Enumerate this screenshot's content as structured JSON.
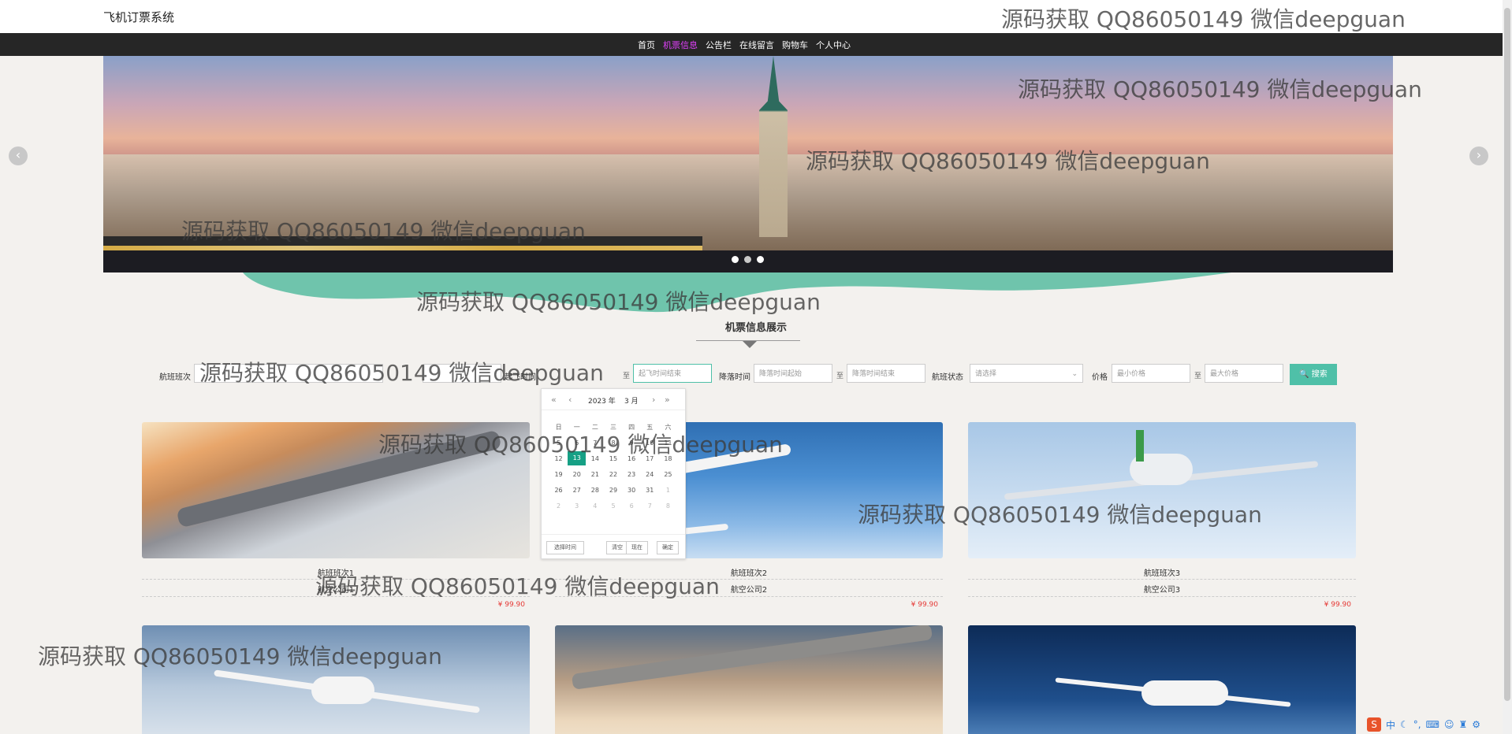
{
  "site": {
    "title": "飞机订票系统"
  },
  "nav": {
    "items": [
      {
        "label": "首页",
        "active": false
      },
      {
        "label": "机票信息",
        "active": true
      },
      {
        "label": "公告栏",
        "active": false
      },
      {
        "label": "在线留言",
        "active": false
      },
      {
        "label": "购物车",
        "active": false
      },
      {
        "label": "个人中心",
        "active": false
      }
    ]
  },
  "banner": {
    "prev_icon": "‹",
    "next_icon": "›",
    "dot_count": 3,
    "active_dot": 2
  },
  "section": {
    "title": "机票信息展示"
  },
  "search": {
    "flight_label": "航班班次",
    "takeoff_label": "起飞时间",
    "landing_label": "降落时间",
    "status_label": "航班状态",
    "price_label": "价格",
    "to": "至",
    "landing_start_placeholder": "降落时间起始",
    "landing_end_placeholder": "降落时间结束",
    "takeoff_end_placeholder": "起飞时间结束",
    "status_placeholder": "请选择",
    "min_price_placeholder": "最小价格",
    "max_price_placeholder": "最大价格",
    "search_button": "🔍 搜索",
    "accent_color": "#4fc0a8"
  },
  "calendar": {
    "year": "2023 年",
    "month": "3 月",
    "weekdays": [
      "日",
      "一",
      "二",
      "三",
      "四",
      "五",
      "六"
    ],
    "rows": [
      [
        "5",
        "6",
        "7",
        "8",
        "9",
        "10",
        "11"
      ],
      [
        "12",
        "13",
        "14",
        "15",
        "16",
        "17",
        "18"
      ],
      [
        "19",
        "20",
        "21",
        "22",
        "23",
        "24",
        "25"
      ],
      [
        "26",
        "27",
        "28",
        "29",
        "30",
        "31",
        "1"
      ],
      [
        "2",
        "3",
        "4",
        "5",
        "6",
        "7",
        "8"
      ]
    ],
    "selected": "13",
    "select_time": "选择时间",
    "clear": "清空",
    "now": "现在",
    "confirm": "确定",
    "selected_color": "#16a085"
  },
  "flights": [
    {
      "name": "航班班次1",
      "airline": "航空公司1",
      "price": "¥ 99.90"
    },
    {
      "name": "航班班次2",
      "airline": "航空公司2",
      "price": "¥ 99.90"
    },
    {
      "name": "航班班次3",
      "airline": "航空公司3",
      "price": "¥ 99.90"
    }
  ],
  "watermark": "源码获取 QQ86050149 微信deepguan",
  "ime": {
    "logo": "S",
    "mode": "中"
  }
}
